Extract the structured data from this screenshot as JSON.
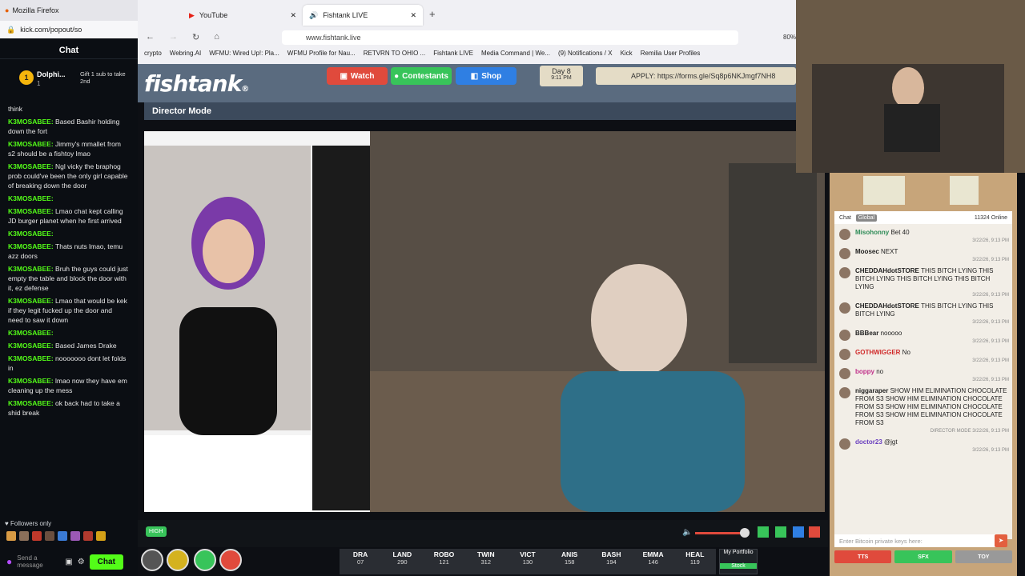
{
  "left_chat": {
    "browser_title": "Mozilla Firefox",
    "url": "kick.com/popout/so",
    "title": "Chat",
    "top_user": "Dolphi...",
    "top_user_count": "1",
    "gift_text": "Gift 1 sub to take 2nd",
    "messages": [
      {
        "user": "",
        "text": "think"
      },
      {
        "user": "K3MOSABEE:",
        "text": "Based Bashir holding down the fort"
      },
      {
        "user": "K3MOSABEE:",
        "text": "Jimmy's mmallet from s2 should be a fishtoy lmao"
      },
      {
        "user": "K3MOSABEE:",
        "text": "Ngl vicky the braphog prob could've been the only girl capable of breaking down the door"
      },
      {
        "user": "K3MOSABEE:",
        "text": ""
      },
      {
        "user": "K3MOSABEE:",
        "text": "Lmao chat kept calling JD burger planet when he first arrived"
      },
      {
        "user": "K3MOSABEE:",
        "text": ""
      },
      {
        "user": "K3MOSABEE:",
        "text": "Thats nuts lmao, temu azz doors"
      },
      {
        "user": "K3MOSABEE:",
        "text": "Bruh the guys could just empty the table and block the door with it, ez defense"
      },
      {
        "user": "K3MOSABEE:",
        "text": "Lmao that would be kek if they legit fucked up the door and need to saw it down"
      },
      {
        "user": "K3MOSABEE:",
        "text": ""
      },
      {
        "user": "K3MOSABEE:",
        "text": "Based James Drake"
      },
      {
        "user": "K3MOSABEE:",
        "text": "nooooooo dont let folds in"
      },
      {
        "user": "K3MOSABEE:",
        "text": "lmao now they have em cleaning up the mess"
      },
      {
        "user": "K3MOSABEE:",
        "text": "ok back had to take a shid break"
      }
    ],
    "followers_only": "Followers only",
    "send_placeholder": "Send a message",
    "chat_button": "Chat"
  },
  "browser": {
    "tab1": "YouTube",
    "tab2": "Fishtank LIVE",
    "url": "www.fishtank.live",
    "zoom": "80%",
    "bookmarks": [
      "crypto",
      "Webring.AI",
      "WFMU: Wired Up!: Pla...",
      "WFMU Profile for Nau...",
      "RETVRN TO OHIO ...",
      "Fishtank LIVE",
      "Media Command | We...",
      "(9) Notifications / X",
      "Kick",
      "Remilia User Profiles"
    ]
  },
  "site": {
    "logo": "fishtank",
    "logo_mark": "®",
    "watch": "Watch",
    "contestants": "Contestants",
    "shop": "Shop",
    "day": "Day 8",
    "time": "9:11 PM",
    "apply": "APPLY: https://forms.gle/Sq8p6NKJmgf7NH8",
    "director_mode": "Director Mode",
    "quality_badge": "HIGH"
  },
  "ticker": [
    {
      "name": "DRA",
      "value": "07"
    },
    {
      "name": "LAND",
      "value": "290"
    },
    {
      "name": "ROBO",
      "value": "121"
    },
    {
      "name": "TWIN",
      "value": "312"
    },
    {
      "name": "VICT",
      "value": "130"
    },
    {
      "name": "ANIS",
      "value": "158"
    },
    {
      "name": "BASH",
      "value": "194"
    },
    {
      "name": "EMMA",
      "value": "146"
    },
    {
      "name": "HEAL",
      "value": "119"
    }
  ],
  "portfolio": {
    "label": "My Portfolio",
    "stock": "Stock"
  },
  "right_chat": {
    "tab": "Chat",
    "global": "Global",
    "online": "11324 Online",
    "messages": [
      {
        "name": "Misohonny",
        "text": "Bet 40",
        "ts": "3/22/26, 9:13 PM",
        "color": "#2e8b57"
      },
      {
        "name": "Moosec",
        "text": "NEXT",
        "ts": "3/22/26, 9:13 PM",
        "color": "#222222"
      },
      {
        "name": "CHEDDAHdotSTORE",
        "text": "THIS BITCH LYING THIS BITCH LYING THIS BITCH LYING THIS BITCH LYING",
        "ts": "3/22/26, 9:13 PM",
        "color": "#222222"
      },
      {
        "name": "CHEDDAHdotSTORE",
        "text": "THIS BITCH LYING THIS BITCH LYING",
        "ts": "3/22/26, 9:13 PM",
        "color": "#222222"
      },
      {
        "name": "BBBear",
        "text": "nooooo",
        "ts": "3/22/26, 9:13 PM",
        "color": "#222222"
      },
      {
        "name": "GOTHWIGGER",
        "text": "No",
        "ts": "3/22/26, 9:13 PM",
        "color": "#d02a2a"
      },
      {
        "name": "boppy",
        "text": "no",
        "ts": "3/22/26, 9:13 PM",
        "color": "#c0308a"
      },
      {
        "name": "niggaraper",
        "text": "SHOW HIM ELIMINATION CHOCOLATE FROM S3 SHOW HIM ELIMINATION CHOCOLATE FROM S3 SHOW HIM ELIMINATION CHOCOLATE FROM S3 SHOW HIM ELIMINATION CHOCOLATE FROM S3",
        "ts": "DIRECTOR MODE 3/22/26, 9:13 PM",
        "color": "#222222"
      },
      {
        "name": "doctor23",
        "text": "@jgt",
        "ts": "3/22/26, 9:13 PM",
        "color": "#6a3fbf"
      }
    ],
    "input_placeholder": "Enter Bitcoin private keys here:",
    "tts": "TTS",
    "sfx": "SFX",
    "toy": "TOY"
  },
  "colors": {
    "kick_green": "#53fc18",
    "watch": "#e04a3c",
    "contestants": "#38c45a",
    "shop": "#2f7fe3"
  }
}
